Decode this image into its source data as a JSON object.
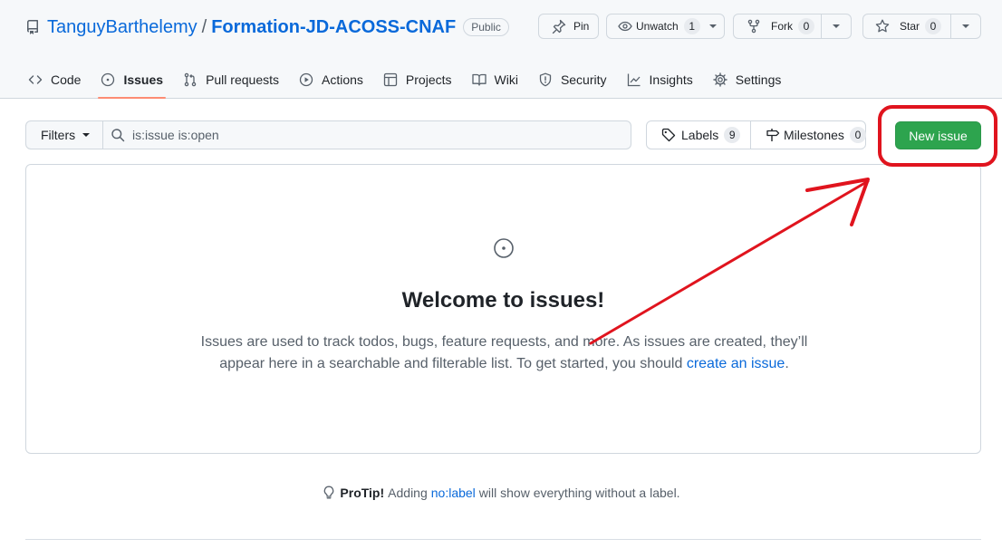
{
  "repo": {
    "owner": "TanguyBarthelemy",
    "separator": "/",
    "name": "Formation-JD-ACOSS-CNAF",
    "visibility": "Public",
    "icon": "repo-icon"
  },
  "actions": {
    "pin": {
      "label": "Pin",
      "icon": "pin-icon"
    },
    "unwatch": {
      "label": "Unwatch",
      "count": "1",
      "icon": "eye-icon"
    },
    "fork": {
      "label": "Fork",
      "count": "0",
      "icon": "fork-icon"
    },
    "star": {
      "label": "Star",
      "count": "0",
      "icon": "star-icon"
    }
  },
  "tabs": [
    {
      "label": "Code",
      "icon": "code-icon"
    },
    {
      "label": "Issues",
      "icon": "issue-opened-icon",
      "selected": true
    },
    {
      "label": "Pull requests",
      "icon": "git-pull-request-icon"
    },
    {
      "label": "Actions",
      "icon": "play-icon"
    },
    {
      "label": "Projects",
      "icon": "table-icon"
    },
    {
      "label": "Wiki",
      "icon": "book-icon"
    },
    {
      "label": "Security",
      "icon": "shield-icon"
    },
    {
      "label": "Insights",
      "icon": "graph-icon"
    },
    {
      "label": "Settings",
      "icon": "gear-icon"
    }
  ],
  "toolbar": {
    "filters_label": "Filters",
    "search_value": "is:issue is:open",
    "labels_label": "Labels",
    "labels_count": "9",
    "milestones_label": "Milestones",
    "milestones_count": "0",
    "new_issue_label": "New issue"
  },
  "blankslate": {
    "title": "Welcome to issues!",
    "text_before": "Issues are used to track todos, bugs, feature requests, and more. As issues are created, they’ll appear here in a searchable and filterable list. To get started, you should ",
    "link_text": "create an issue",
    "text_after": "."
  },
  "protip": {
    "bold": "ProTip!",
    "before": "Adding",
    "link": "no:label",
    "after": "will show everything without a label."
  },
  "colors": {
    "accent": "#0969da",
    "primary_button": "#2da44e",
    "selected_tab_underline": "#fd8c73",
    "annotation": "#e0141e"
  }
}
